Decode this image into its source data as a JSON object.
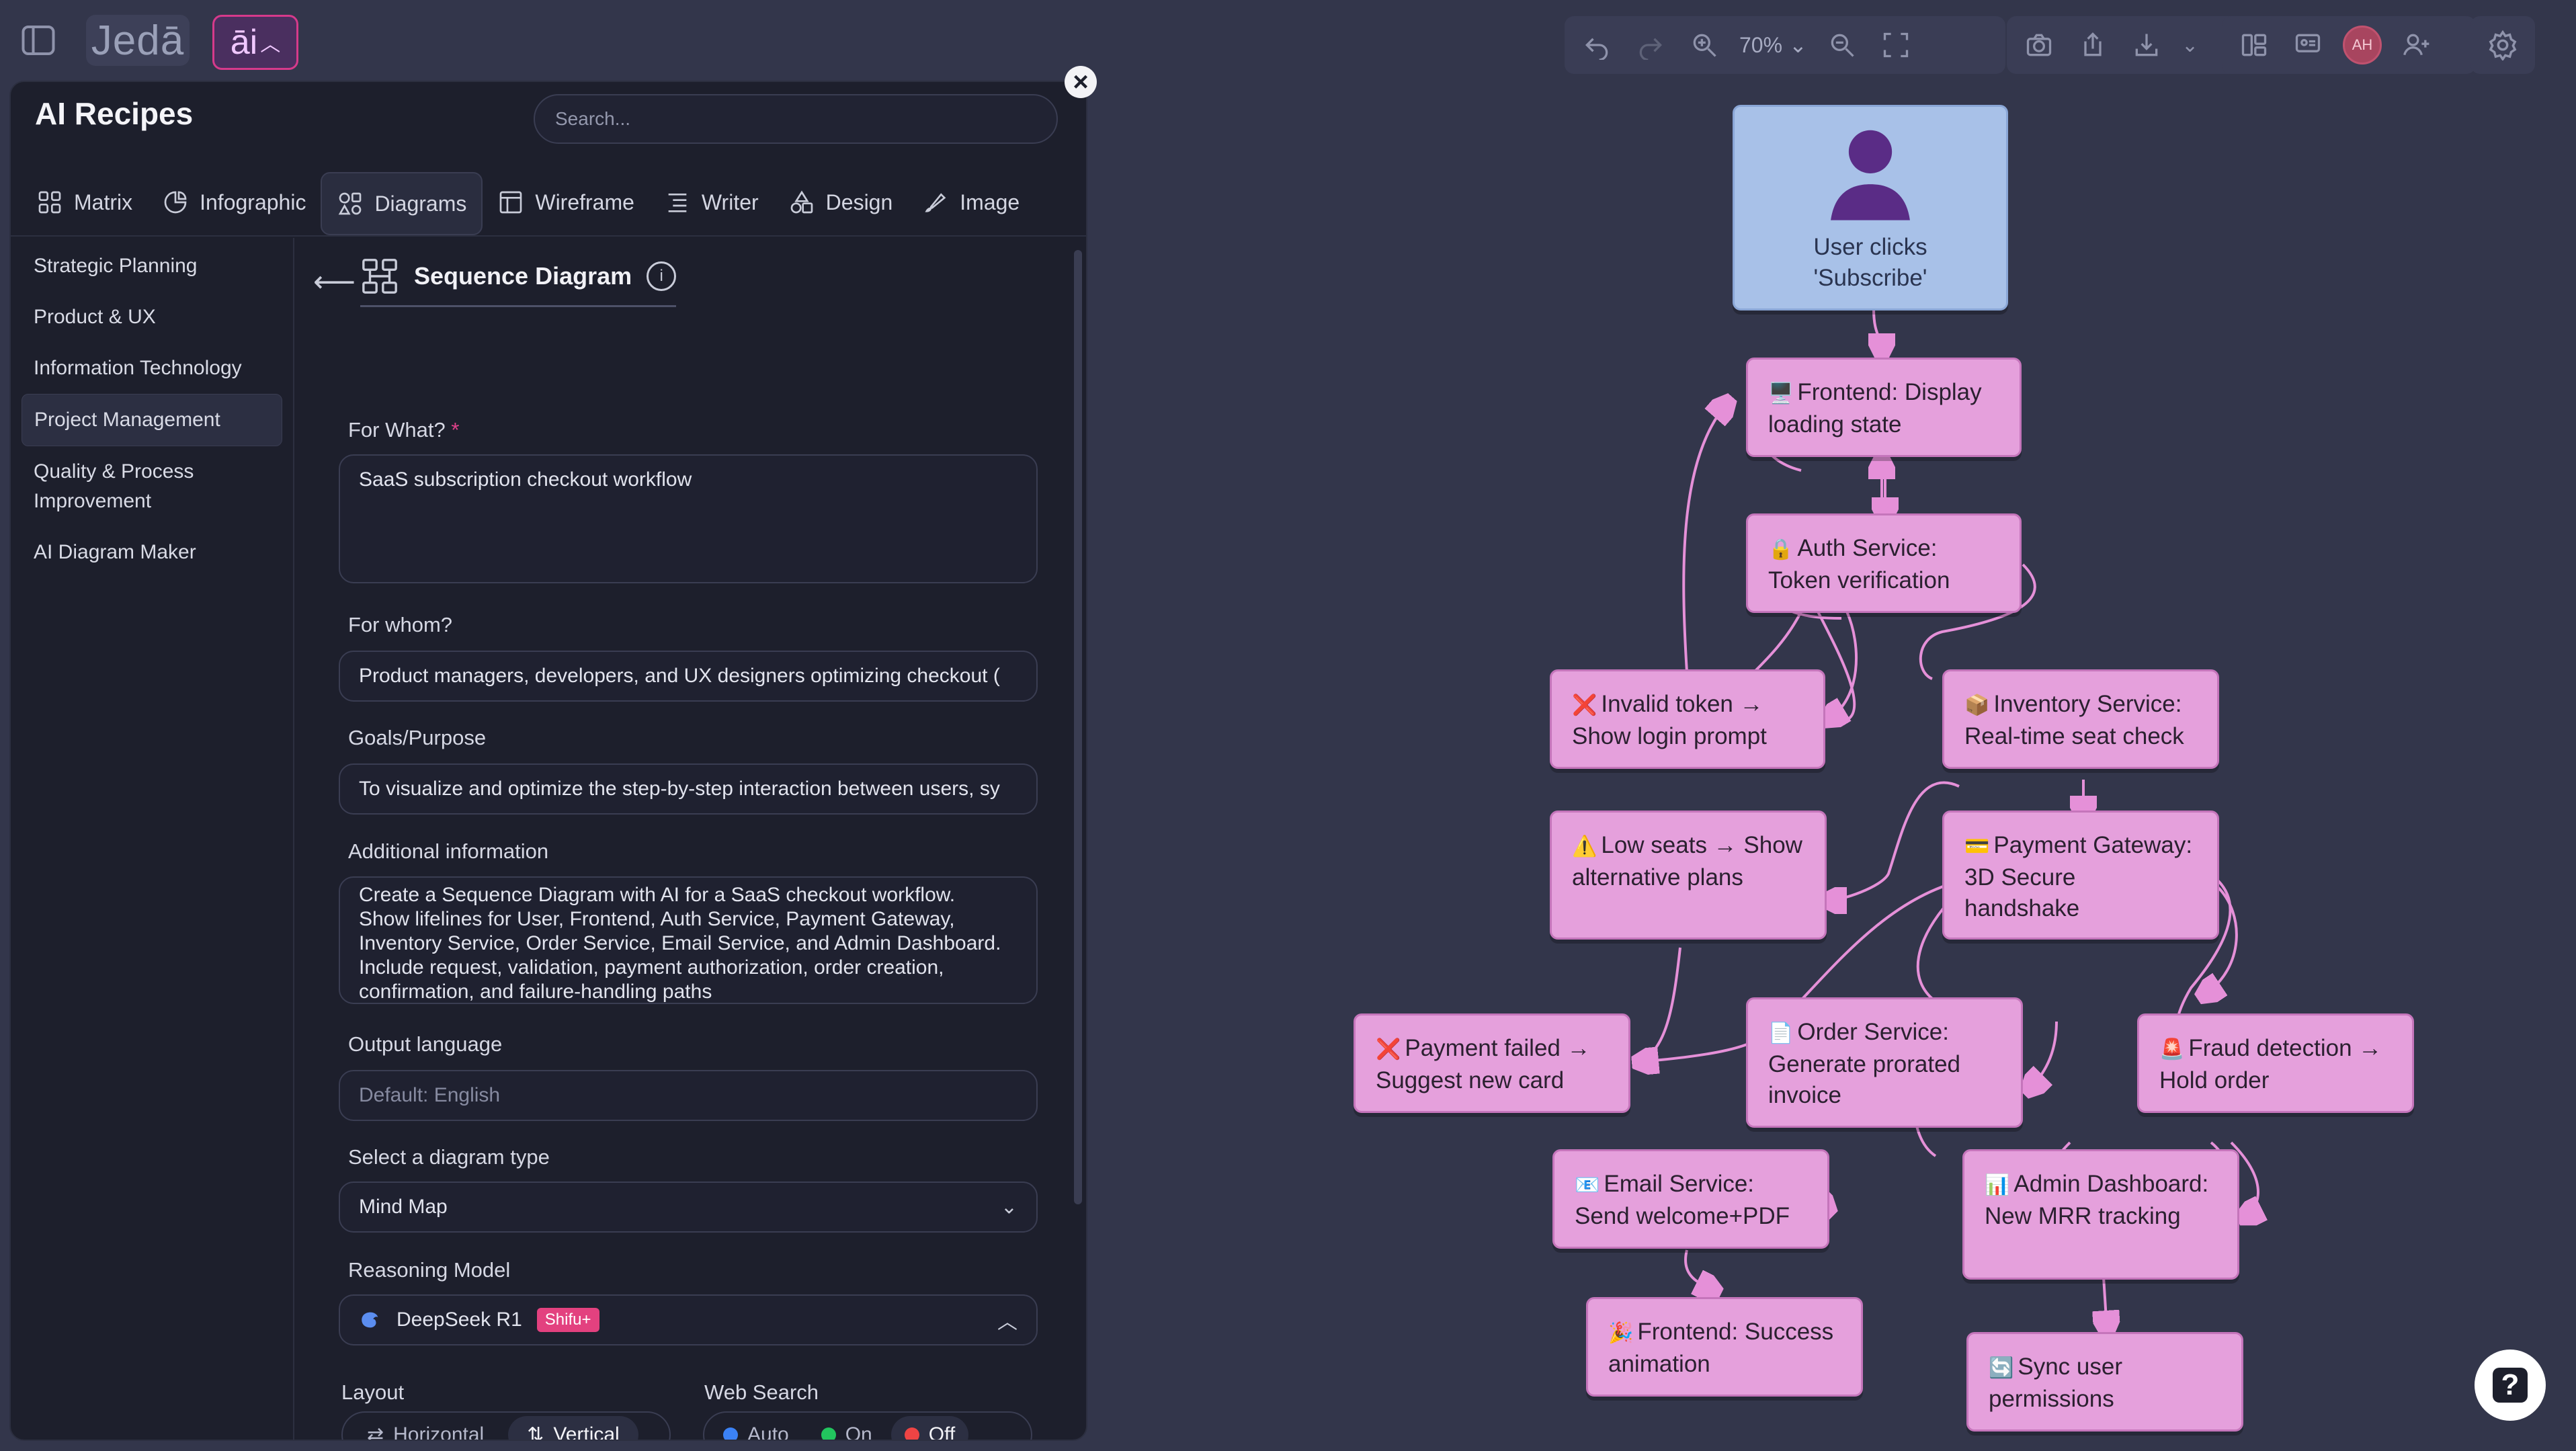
{
  "topbar": {
    "logo": "Jedā",
    "ai_button": "āi"
  },
  "toolbar": {
    "zoom": "70%",
    "avatar_initials": "AH"
  },
  "panel": {
    "title": "AI Recipes",
    "search_placeholder": "Search...",
    "tabs": [
      "Matrix",
      "Infographic",
      "Diagrams",
      "Wireframe",
      "Writer",
      "Design",
      "Image"
    ],
    "active_tab": "Diagrams",
    "categories": [
      "Strategic Planning",
      "Product & UX",
      "Information Technology",
      "Project Management",
      "Quality & Process Improvement",
      "AI Diagram Maker"
    ],
    "active_category": "Project Management"
  },
  "form": {
    "recipe_title": "Sequence Diagram",
    "for_what_label": "For What?",
    "for_what_value": "SaaS subscription checkout workflow",
    "for_whom_label": "For whom?",
    "for_whom_value": "Product managers, developers, and UX designers optimizing checkout (",
    "goals_label": "Goals/Purpose",
    "goals_value": "To visualize and optimize the step-by-step interaction between users, sy",
    "additional_label": "Additional information",
    "additional_value": "Create a Sequence Diagram with AI for a SaaS checkout workflow. Show lifelines for User, Frontend, Auth Service, Payment Gateway, Inventory Service, Order Service, Email Service, and Admin Dashboard. Include request, validation, payment authorization, order creation, confirmation, and failure-handling paths",
    "output_language_label": "Output language",
    "output_language_placeholder": "Default: English",
    "diagram_type_label": "Select a diagram type",
    "diagram_type_value": "Mind Map",
    "reasoning_label": "Reasoning Model",
    "reasoning_value": "DeepSeek R1",
    "reasoning_badge": "Shifu+",
    "layout_label": "Layout",
    "layout_options": [
      "Horizontal",
      "Vertical"
    ],
    "layout_selected": "Vertical",
    "websearch_label": "Web Search",
    "websearch_options": [
      "Auto",
      "On",
      "Off"
    ],
    "websearch_selected": "Off",
    "colors": {
      "auto": "#3b82f6",
      "on": "#22c55e",
      "off": "#ef4444"
    }
  },
  "diagram": {
    "nodes": {
      "user": "User clicks 'Subscribe'",
      "frontend_loading": "Frontend: Display loading state",
      "auth": "Auth Service: Token verification",
      "invalid_token": "Invalid token → Show login prompt",
      "inventory": "Inventory Service: Real-time seat check",
      "low_seats": "Low seats → Show alternative plans",
      "payment": "Payment Gateway: 3D Secure handshake",
      "payment_failed": "Payment failed → Suggest new card",
      "order": "Order Service: Generate prorated invoice",
      "fraud": "Fraud detection → Hold order",
      "email": "Email Service: Send welcome+PDF",
      "admin": "Admin Dashboard: New MRR tracking",
      "frontend_success": "Frontend: Success animation",
      "sync": "Sync user permissions"
    },
    "emoji": {
      "frontend_loading": "🖥️",
      "auth": "🔒",
      "invalid_token": "❌",
      "inventory": "📦",
      "low_seats": "⚠️",
      "payment": "💳",
      "payment_failed": "❌",
      "order": "📄",
      "fraud": "🚨",
      "email": "📧",
      "admin": "📊",
      "frontend_success": "🎉",
      "sync": "🔄"
    },
    "node_color": "#e5a0dc",
    "user_node_color": "#a8c1e8",
    "edge_color": "#e590d8"
  }
}
